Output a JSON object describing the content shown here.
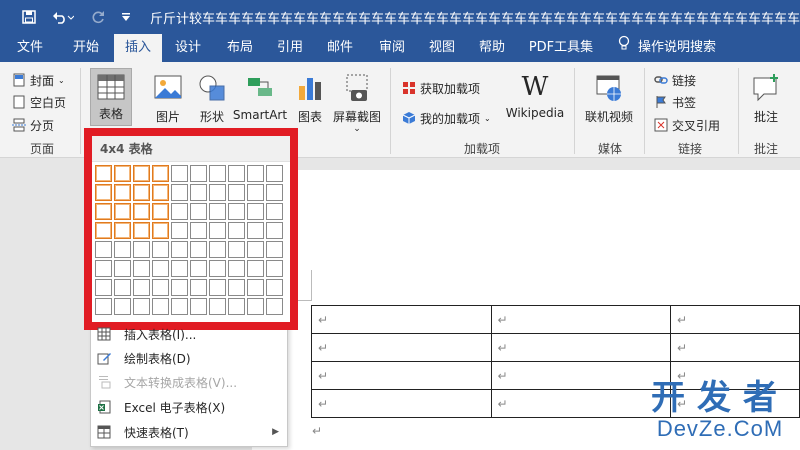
{
  "title_bar": {
    "document_title": "斤斤计较车车车车车车车车车车车车车车车车车车车车车车车车车车车车车车车车车车车车车车车车车车车车车车车车车车"
  },
  "tabs": [
    "文件",
    "开始",
    "插入",
    "设计",
    "布局",
    "引用",
    "邮件",
    "审阅",
    "视图",
    "帮助",
    "PDF工具集"
  ],
  "active_tab": "插入",
  "tell_me": "操作说明搜索",
  "ribbon": {
    "pages_group": {
      "cover": "封面",
      "blank_page": "空白页",
      "page_break": "分页",
      "label": "页面"
    },
    "table_button": "表格",
    "illustrations": {
      "picture": "图片",
      "shapes": "形状",
      "smartart": "SmartArt",
      "chart": "图表",
      "screenshot": "屏幕截图"
    },
    "addins": {
      "get_addins": "获取加载项",
      "my_addins": "我的加载项",
      "wikipedia": "Wikipedia",
      "label": "加载项"
    },
    "media": {
      "online_video": "联机视频",
      "label": "媒体"
    },
    "links": {
      "link": "链接",
      "bookmark": "书签",
      "cross_ref": "交叉引用",
      "label": "链接"
    },
    "comments": {
      "comment": "批注",
      "label": "批注"
    }
  },
  "table_dropdown": {
    "grid_header": "4x4 表格",
    "grid_cols": 10,
    "grid_rows": 8,
    "selected_cols": 4,
    "selected_rows": 4,
    "menu": [
      {
        "label": "插入表格(I)...",
        "enabled": true
      },
      {
        "label": "绘制表格(D)",
        "enabled": true
      },
      {
        "label": "文本转换成表格(V)...",
        "enabled": false
      },
      {
        "label": "Excel 电子表格(X)",
        "enabled": true
      },
      {
        "label": "快速表格(T)",
        "enabled": true,
        "submenu": true
      }
    ]
  },
  "document": {
    "paragraph_mark": "↵",
    "table_rows": 4,
    "table_cols": 3
  },
  "watermark": {
    "top": "开发者",
    "bottom": "DevZe.CoM"
  },
  "colors": {
    "brand": "#2b579a",
    "highlight_border": "#e11c24",
    "selection": "#e07a1f"
  }
}
